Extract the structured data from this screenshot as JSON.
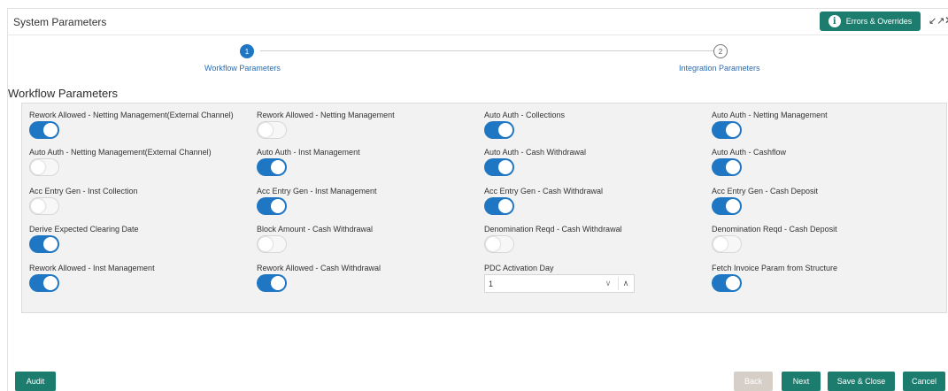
{
  "window": {
    "title": "System Parameters",
    "errors_button": "Errors & Overrides",
    "collapse_glyph": "↙↗",
    "close_glyph": "✕"
  },
  "stepper": {
    "steps": [
      {
        "number": "1",
        "label": "Workflow Parameters",
        "active": true
      },
      {
        "number": "2",
        "label": "Integration Parameters",
        "active": false
      }
    ]
  },
  "section": {
    "title": "Workflow Parameters"
  },
  "fields": [
    {
      "label": "Rework Allowed - Netting Management(External Channel)",
      "type": "toggle",
      "on": true
    },
    {
      "label": "Rework Allowed - Netting Management",
      "type": "toggle",
      "on": false
    },
    {
      "label": "Auto Auth - Collections",
      "type": "toggle",
      "on": true
    },
    {
      "label": "Auto Auth - Netting Management",
      "type": "toggle",
      "on": true
    },
    {
      "label": "Auto Auth - Netting Management(External Channel)",
      "type": "toggle",
      "on": false
    },
    {
      "label": "Auto Auth - Inst Management",
      "type": "toggle",
      "on": true
    },
    {
      "label": "Auto Auth - Cash Withdrawal",
      "type": "toggle",
      "on": true
    },
    {
      "label": "Auto Auth - Cashflow",
      "type": "toggle",
      "on": true
    },
    {
      "label": "Acc Entry Gen - Inst Collection",
      "type": "toggle",
      "on": false
    },
    {
      "label": "Acc Entry Gen - Inst Management",
      "type": "toggle",
      "on": true
    },
    {
      "label": "Acc Entry Gen - Cash Withdrawal",
      "type": "toggle",
      "on": true
    },
    {
      "label": "Acc Entry Gen - Cash Deposit",
      "type": "toggle",
      "on": true
    },
    {
      "label": "Derive Expected Clearing Date",
      "type": "toggle",
      "on": true
    },
    {
      "label": "Block Amount - Cash Withdrawal",
      "type": "toggle",
      "on": false
    },
    {
      "label": "Denomination Reqd - Cash Withdrawal",
      "type": "toggle",
      "on": false
    },
    {
      "label": "Denomination Reqd - Cash Deposit",
      "type": "toggle",
      "on": false
    },
    {
      "label": "Rework Allowed - Inst Management",
      "type": "toggle",
      "on": true
    },
    {
      "label": "Rework Allowed - Cash Withdrawal",
      "type": "toggle",
      "on": true
    },
    {
      "label": "PDC Activation Day",
      "type": "number",
      "value": "1"
    },
    {
      "label": "Fetch Invoice Param from Structure",
      "type": "toggle",
      "on": true
    }
  ],
  "footer": {
    "audit": "Audit",
    "back": "Back",
    "next": "Next",
    "save_close": "Save & Close",
    "cancel": "Cancel"
  },
  "colors": {
    "primary": "#1f76c2",
    "teal": "#1c7d6e",
    "disabled": "#d5cfc8"
  }
}
